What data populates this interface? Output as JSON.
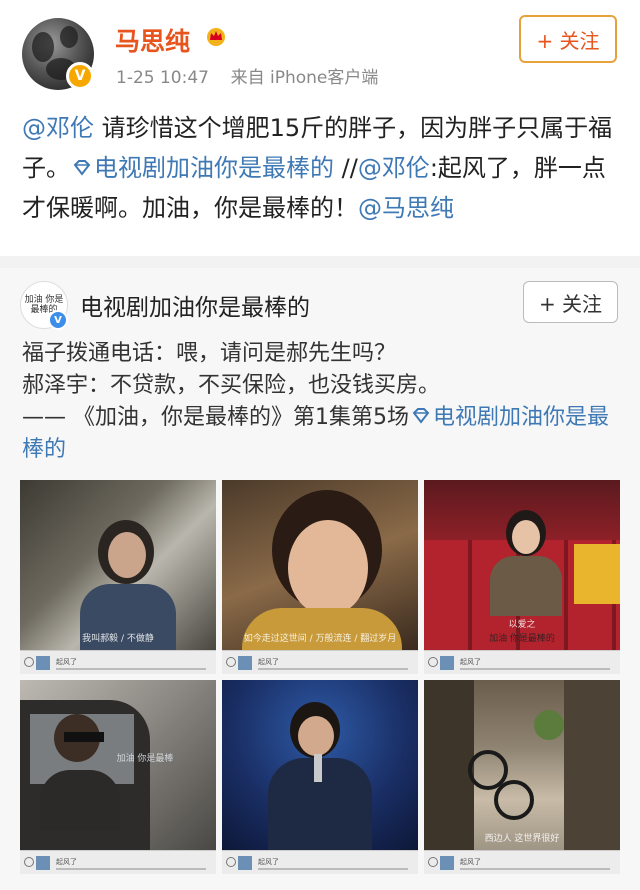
{
  "post": {
    "user_name": "马思纯",
    "timestamp": "1-25 10:47",
    "source": "来自 iPhone客户端",
    "follow_label": "+ 关注",
    "text": {
      "mention1": "@邓伦",
      "part1": " 请珍惜这个增肥15斤的胖子，因为胖子只属于福子。",
      "topic": "电视剧加油你是最棒的",
      "part2": " //",
      "mention2": "@邓伦",
      "part3": ":起风了，胖一点才保暖啊。加油，你是最棒的！",
      "mention3": "@马思纯"
    }
  },
  "card": {
    "avatar_text": "加油 你是最棒的",
    "name": "电视剧加油你是最棒的",
    "follow_label": "+ 关注",
    "line1": "福子拨通电话：喂，请问是郝先生吗？",
    "line2": "郝泽宇：不贷款，不买保险，也没钱买房。",
    "line3_prefix": "—— 《加油，你是最棒的》第1集第5场",
    "line3_topic": "电视剧加油你是最棒的",
    "images": [
      {
        "caption": "我叫郝毅 / 不做静",
        "overlay": "你是最棒的",
        "song": "起风了"
      },
      {
        "caption": "如今走过这世间 / 万般流连 / 翻过岁月",
        "overlay": "",
        "song": "起风了"
      },
      {
        "caption": "以爱之",
        "overlay": "加油 你是最棒的",
        "song": "起风了"
      },
      {
        "caption": "",
        "overlay": "加油 你是最棒",
        "song": "起风了"
      },
      {
        "caption": "",
        "overlay": "",
        "song": "起风了"
      },
      {
        "caption": "西边人 这世界很好",
        "overlay": "",
        "song": "起风了"
      }
    ]
  },
  "colors": {
    "orange": "#e8541e",
    "link": "#3f79b5",
    "follow_border": "#e8a23c"
  }
}
